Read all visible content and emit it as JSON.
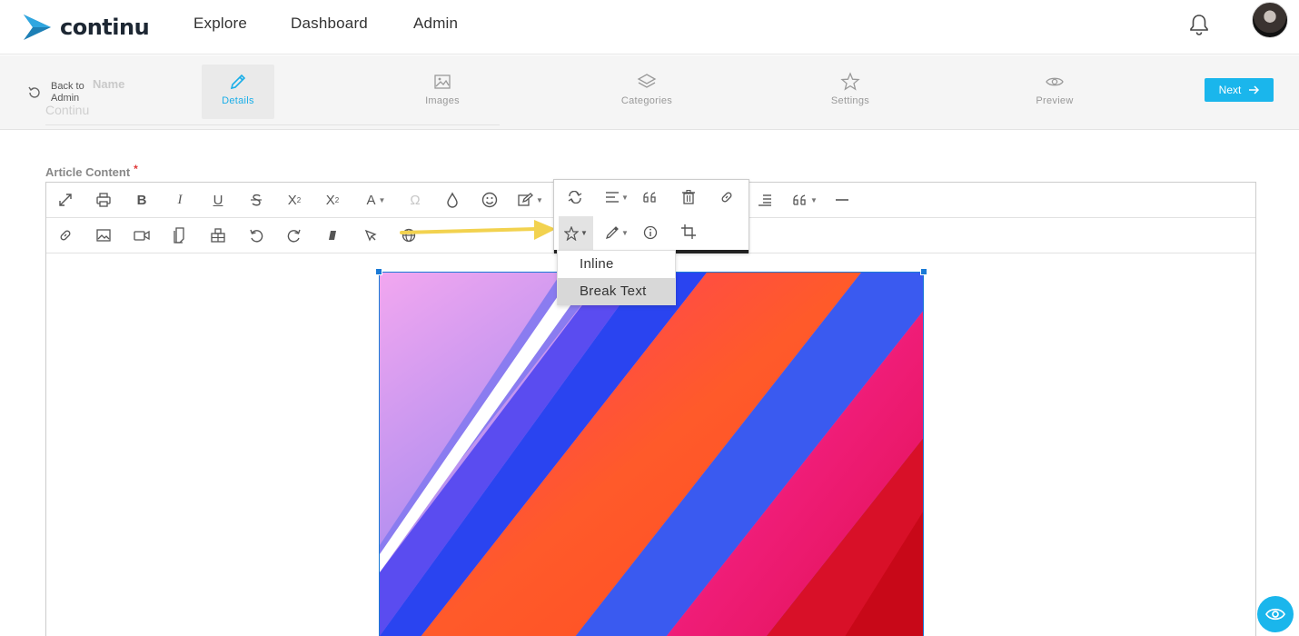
{
  "brand": {
    "name": "continu",
    "accent": "#1ab6ec",
    "logo_color": "#1d7fb5"
  },
  "nav": {
    "items": [
      "Explore",
      "Dashboard",
      "Admin"
    ]
  },
  "header": {
    "bell_icon": "bell-icon",
    "avatar_icon": "user-avatar"
  },
  "wizard": {
    "back_label": "Back to Admin",
    "ghost_field_label": "Name",
    "ghost_field_value": "Continu",
    "steps": [
      {
        "label": "Details",
        "icon": "pencil-icon",
        "active": true
      },
      {
        "label": "Images",
        "icon": "image-icon",
        "active": false
      },
      {
        "label": "Categories",
        "icon": "layers-icon",
        "active": false
      },
      {
        "label": "Settings",
        "icon": "star-icon",
        "active": false
      },
      {
        "label": "Preview",
        "icon": "eye-icon",
        "active": false
      }
    ],
    "next_label": "Next"
  },
  "content": {
    "label": "Article Content",
    "required_mark": "*"
  },
  "toolbar": {
    "row1": [
      "fullscreen",
      "print",
      "bold",
      "italic",
      "underline",
      "strikethrough",
      "subscript",
      "superscript",
      "font-color",
      "special-characters",
      "color-drop",
      "emoticons",
      "paragraph-style",
      "indent",
      "quote",
      "horizontal-line"
    ],
    "row2": [
      "insert-link",
      "insert-image",
      "insert-video",
      "insert-file",
      "insert-table",
      "undo",
      "redo",
      "clear-formatting",
      "select-all",
      "globe"
    ],
    "text_glyphs": {
      "bold": "B",
      "italic": "I",
      "underline": "U",
      "strike": "S",
      "subscript": "X",
      "superscript": "X",
      "font": "A",
      "omega": "Ω"
    }
  },
  "image_popup": {
    "buttons": [
      "replace-image",
      "align",
      "quote",
      "remove-image",
      "link-image",
      "display-star",
      "style",
      "alt-info",
      "crop"
    ],
    "dropdown": [
      {
        "label": "Inline",
        "selected": false
      },
      {
        "label": "Break Text",
        "selected": true
      }
    ]
  },
  "colors": {
    "selection": "#1a7ad6",
    "arrow": "#f2d24f"
  }
}
